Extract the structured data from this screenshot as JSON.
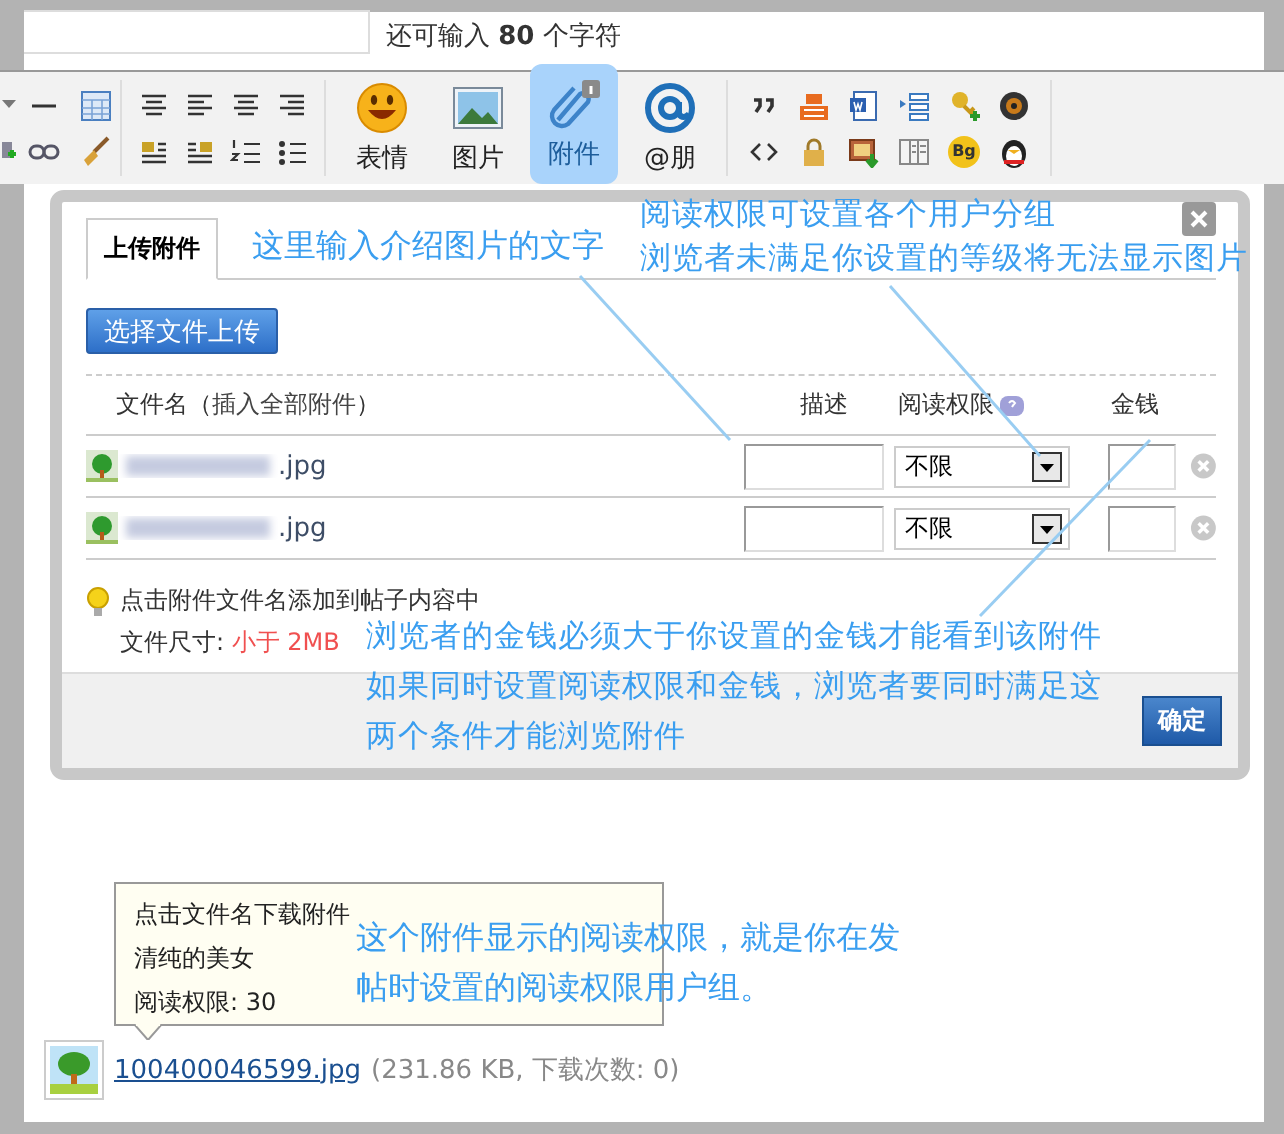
{
  "char_counter": "还可输入 **80** 个字符",
  "toolbar": {
    "buttons": [
      {
        "label": "表情",
        "kind": "smiley",
        "selected": false
      },
      {
        "label": "图片",
        "kind": "image",
        "selected": false
      },
      {
        "label": "附件",
        "kind": "attach",
        "selected": true
      },
      {
        "label": "@朋",
        "kind": "at",
        "selected": false
      }
    ],
    "bg_badge": "Bg"
  },
  "dialog": {
    "tabs": [
      {
        "label": "上传附件",
        "selected": true
      }
    ],
    "upload_button": "选择文件上传",
    "file_column": {
      "before": "文件名（",
      "link": "插入全部附件",
      "after": "）"
    },
    "columns": [
      "描述",
      "阅读权限",
      "金钱"
    ],
    "rows": [
      {
        "name": ".jpg",
        "permission": "不限"
      },
      {
        "name": ".jpg",
        "permission": "不限"
      }
    ],
    "tip": "点击附件文件名添加到帖子内容中",
    "size_label": "文件尺寸: ",
    "size_value": "小于 2MB",
    "confirm_button": "确定"
  },
  "annotations": [
    {
      "lines": [
        "这里输入介绍图片的文字"
      ]
    },
    {
      "lines": [
        "阅读权限可设置各个用户分组",
        "浏览者未满足你设置的等级将无法显示图片"
      ]
    },
    {
      "lines": [
        "浏览者的金钱必须大于你设置的金钱才能看到该附件",
        "如果同时设置阅读权限和金钱，浏览者要同时满足这",
        "两个条件才能浏览附件"
      ]
    },
    {
      "lines": [
        "这个附件显示的阅读权限，就是你在发",
        "帖时设置的阅读权限用户组。"
      ]
    }
  ],
  "attachment": {
    "tooltip": [
      "点击文件名下载附件",
      "清纯的美女",
      "阅读权限: 30"
    ],
    "link": "100400046599.jpg",
    "meta": "(231.86 KB, 下载次数: 0)"
  }
}
